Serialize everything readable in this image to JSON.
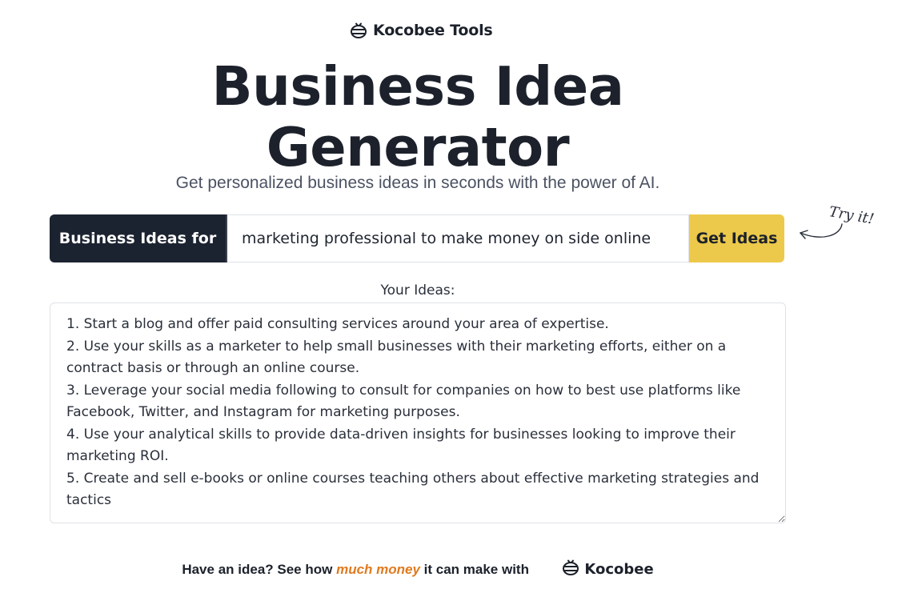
{
  "brand": {
    "name": "Kocobee Tools",
    "icon": "bee-logo-icon"
  },
  "hero": {
    "title": "Business Idea Generator",
    "subtitle": "Get personalized business ideas in seconds with the power of AI."
  },
  "form": {
    "prefix_label": "Business Ideas for",
    "query_value": "marketing professional to make money on side online",
    "submit_label": "Get Ideas",
    "hint_text": "Try it!",
    "hint_icon": "curved-arrow-icon"
  },
  "results": {
    "label": "Your Ideas:",
    "text": "1. Start a blog and offer paid consulting services around your area of expertise.\n2. Use your skills as a marketer to help small businesses with their marketing efforts, either on a contract basis or through an online course.\n3. Leverage your social media following to consult for companies on how to best use platforms like Facebook, Twitter, and Instagram for marketing purposes.\n4. Use your analytical skills to provide data-driven insights for businesses looking to improve their marketing ROI.\n5. Create and sell e-books or online courses teaching others about effective marketing strategies and tactics"
  },
  "footer": {
    "text_before": "Have an idea? See how ",
    "highlight": "much money",
    "text_after": " it can make with",
    "brand_name": "Kocobee",
    "brand_icon": "bee-logo-icon"
  },
  "colors": {
    "dark": "#1c2330",
    "accent_yellow": "#ecc94b",
    "highlight_orange": "#e07a1f"
  }
}
